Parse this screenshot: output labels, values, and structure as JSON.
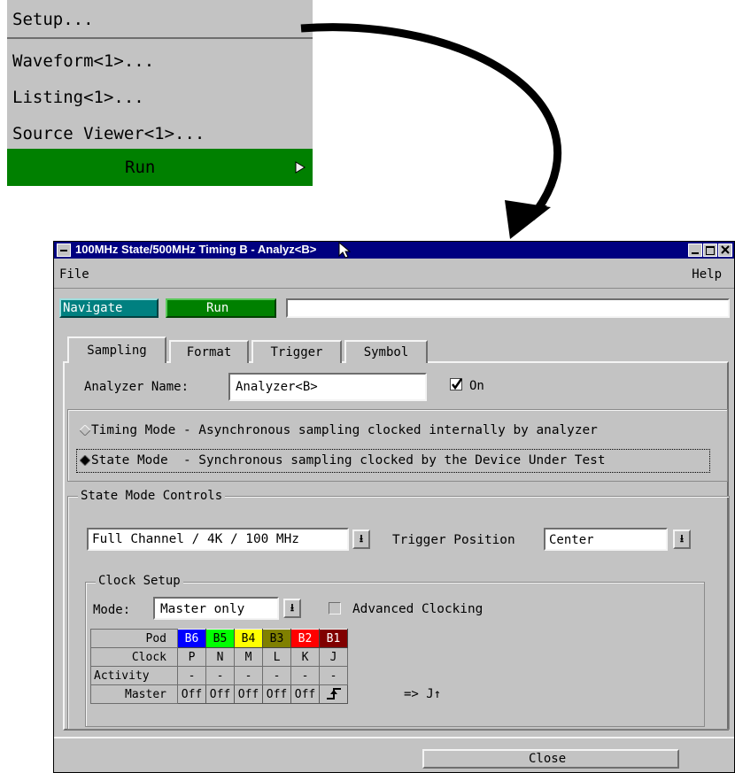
{
  "menu": {
    "items": [
      "Setup...",
      "Waveform<1>...",
      "Listing<1>...",
      "Source Viewer<1>..."
    ],
    "run_label": "Run",
    "run_icon": "play-icon"
  },
  "window": {
    "title_pre": "100MHz State/500MHz Timing B - Analyz",
    "title_post": "<B>",
    "menubar": {
      "file": "File",
      "help": "Help"
    },
    "toolbar": {
      "navigate": "Navigate",
      "run": "Run",
      "status_value": ""
    },
    "tabs": [
      "Sampling",
      "Format",
      "Trigger",
      "Symbol"
    ],
    "analyzer_name_label": "Analyzer Name:",
    "analyzer_name_value": "Analyzer<B>",
    "on_label": "On",
    "on_checked": true,
    "timing_mode_label": "Timing Mode - Asynchronous sampling clocked internally by analyzer",
    "state_mode_label": "State Mode  - Synchronous sampling clocked by the Device Under Test",
    "selected_mode": "State",
    "state_mode_controls_label": "State Mode Controls",
    "acq_mode_value": "Full Channel / 4K / 100 MHz",
    "trigger_position_label": "Trigger Position",
    "trigger_position_value": "Center",
    "clock_setup_label": "Clock Setup",
    "mode_label": "Mode:",
    "mode_value": "Master only",
    "advanced_clocking_label": "Advanced Clocking",
    "advanced_clocking_checked": false,
    "pod_table": {
      "row_labels": [
        "Pod",
        "Clock",
        "Activity",
        "Master"
      ],
      "pods": [
        "B6",
        "B5",
        "B4",
        "B3",
        "B2",
        "B1"
      ],
      "pod_colors": [
        "#0000ff",
        "#00ff00",
        "#ffff00",
        "#808000",
        "#ff0000",
        "#800000"
      ],
      "pod_text_colors": [
        "#ffffff",
        "#000000",
        "#000000",
        "#000000",
        "#ffffff",
        "#ffffff"
      ],
      "clocks": [
        "P",
        "N",
        "M",
        "L",
        "K",
        "J"
      ],
      "activity": [
        "-",
        "-",
        "-",
        "-",
        "-",
        "-"
      ],
      "master": [
        "Off",
        "Off",
        "Off",
        "Off",
        "Off"
      ],
      "master_last_icon": "rising-edge-icon",
      "master_result": "=> J↑"
    },
    "close_label": "Close"
  },
  "colors": {
    "green": "#008000",
    "teal": "#008080",
    "title_bar": "#000080",
    "face": "#c3c3c3"
  }
}
